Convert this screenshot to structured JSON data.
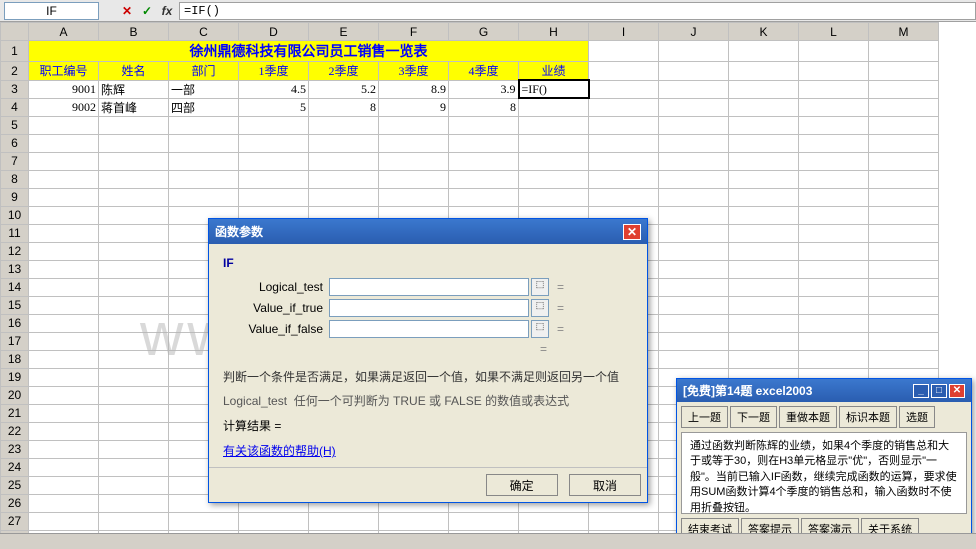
{
  "formula_bar": {
    "name_box": "IF",
    "formula": "=IF()"
  },
  "columns": [
    "A",
    "B",
    "C",
    "D",
    "E",
    "F",
    "G",
    "H",
    "I",
    "J",
    "K",
    "L",
    "M"
  ],
  "row_count": 28,
  "title_row": "徐州鼎德科技有限公司员工销售一览表",
  "headers": [
    "职工编号",
    "姓名",
    "部门",
    "1季度",
    "2季度",
    "3季度",
    "4季度",
    "业绩"
  ],
  "data_rows": [
    {
      "id": "9001",
      "name": "陈辉",
      "dept": "一部",
      "q1": "4.5",
      "q2": "5.2",
      "q3": "8.9",
      "q4": "3.9",
      "perf": "=IF()"
    },
    {
      "id": "9002",
      "name": "蒋首峰",
      "dept": "四部",
      "q1": "5",
      "q2": "8",
      "q3": "9",
      "q4": "8",
      "perf": ""
    }
  ],
  "dialog": {
    "title": "函数参数",
    "fname": "IF",
    "args": [
      {
        "label": "Logical_test",
        "value": ""
      },
      {
        "label": "Value_if_true",
        "value": ""
      },
      {
        "label": "Value_if_false",
        "value": ""
      }
    ],
    "eq": "=",
    "desc1": "判断一个条件是否满足，如果满足返回一个值，如果不满足则返回另一个值",
    "desc2_label": "Logical_test",
    "desc2_text": "任何一个可判断为 TRUE 或 FALSE 的数值或表达式",
    "result_label": "计算结果 =",
    "help_link": "有关该函数的帮助(H)",
    "ok": "确定",
    "cancel": "取消"
  },
  "helper": {
    "title": "[免费]第14题  excel2003",
    "buttons_top": [
      "上一题",
      "下一题",
      "重做本题",
      "标识本题",
      "选题"
    ],
    "body": "通过函数判断陈辉的业绩，如果4个季度的销售总和大于或等于30，则在H3单元格显示\"优\"，否则显示\"一般\"。当前已输入IF函数，继续完成函数的运算，要求使用SUM函数计算4个季度的销售总和，输入函数时不使用折叠按钮。",
    "buttons_bottom": [
      "结束考试",
      "答案提示",
      "答案演示",
      "关于系统"
    ]
  },
  "watermark": "www.docin.com"
}
